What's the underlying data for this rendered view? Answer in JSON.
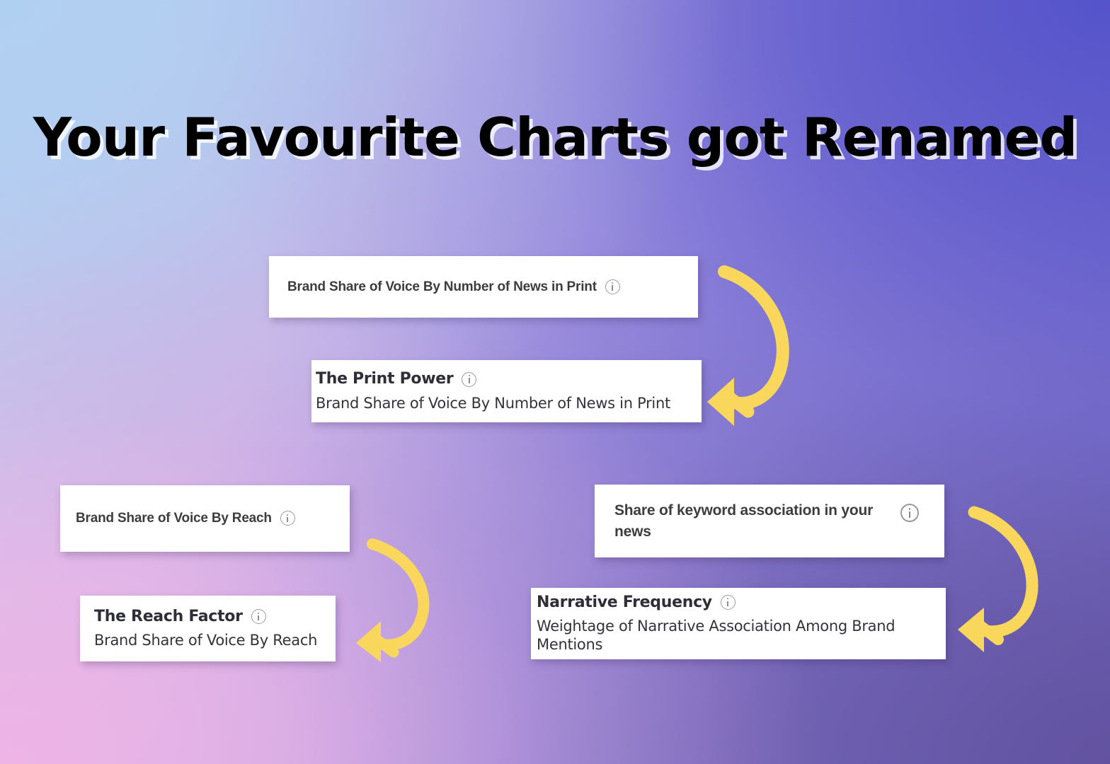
{
  "page": {
    "title": "Your Favourite Charts got Renamed",
    "background": {
      "top_left": "#B0D0F2",
      "top_right": "#5553CA",
      "bottom_left": "#F0B4E6",
      "bottom_right": "#62529E"
    },
    "arrow_color": "#F9D65C"
  },
  "pairs": [
    {
      "id": "print",
      "old": {
        "label": "Brand Share of Voice By Number of News in Print",
        "icon": "info-icon"
      },
      "new": {
        "title": "The Print Power",
        "subtitle": "Brand Share of Voice By Number of News in Print",
        "icon": "info-icon"
      },
      "arrow": "curved-arrow-down-left-icon"
    },
    {
      "id": "reach",
      "old": {
        "label": "Brand Share of Voice By Reach",
        "icon": "info-icon"
      },
      "new": {
        "title": "The Reach Factor",
        "subtitle": "Brand Share of Voice By Reach",
        "icon": "info-icon"
      },
      "arrow": "curved-arrow-down-left-icon"
    },
    {
      "id": "keyword",
      "old": {
        "label": "Share of keyword association in your news",
        "icon": "info-icon"
      },
      "new": {
        "title": "Narrative Frequency",
        "subtitle": "Weightage of Narrative Association Among Brand Mentions",
        "icon": "info-icon"
      },
      "arrow": "curved-arrow-down-left-icon"
    }
  ]
}
